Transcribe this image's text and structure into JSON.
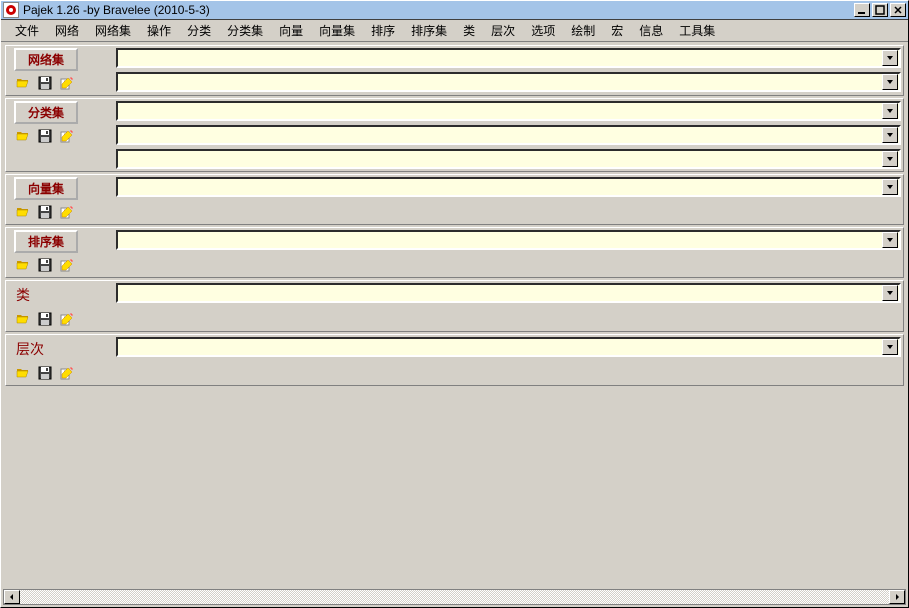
{
  "window": {
    "title": "Pajek 1.26 -by Bravelee (2010-5-3)"
  },
  "menu": [
    "文件",
    "网络",
    "网络集",
    "操作",
    "分类",
    "分类集",
    "向量",
    "向量集",
    "排序",
    "排序集",
    "类",
    "层次",
    "选项",
    "绘制",
    "宏",
    "信息",
    "工具集"
  ],
  "panels": [
    {
      "label": "网络集",
      "btnStyle": true,
      "combos": 2
    },
    {
      "label": "分类集",
      "btnStyle": true,
      "combos": 3
    },
    {
      "label": "向量集",
      "btnStyle": true,
      "combos": 1
    },
    {
      "label": "排序集",
      "btnStyle": true,
      "combos": 1
    },
    {
      "label": "类",
      "btnStyle": false,
      "combos": 1
    },
    {
      "label": "层次",
      "btnStyle": false,
      "combos": 1
    }
  ],
  "icons": {
    "open": "folder-open-icon",
    "save": "save-icon",
    "edit": "edit-icon"
  },
  "combo_values": {
    "p0": [
      "",
      ""
    ],
    "p1": [
      "",
      "",
      ""
    ],
    "p2": [
      ""
    ],
    "p3": [
      ""
    ],
    "p4": [
      ""
    ],
    "p5": [
      ""
    ]
  }
}
